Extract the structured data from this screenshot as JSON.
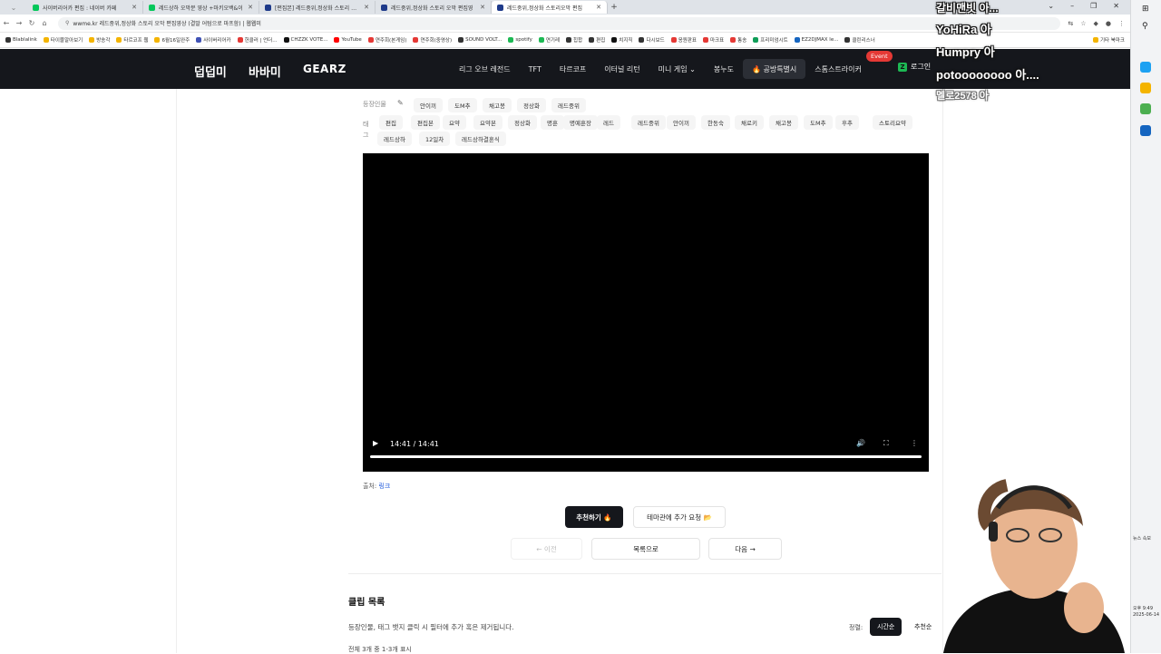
{
  "browser": {
    "tabs": [
      {
        "label": "사이버리어카 편집 : 네이버 카페",
        "color": "#03c75a"
      },
      {
        "label": "레드상하 오막분 영상 +마키오백&이",
        "color": "#03c75a"
      },
      {
        "label": "[편집본] 레드중위,정상화 스토리 오막",
        "color": "#1e3a8a"
      },
      {
        "label": "레드중위,정상화 스토리 오막 편집영",
        "color": "#1e3a8a"
      },
      {
        "label": "레드중위,정상화 스토리오막 편집",
        "color": "#1e3a8a"
      }
    ],
    "new_tab": "+",
    "url": "wwme.kr 레드중위,정상화 스토리 오막 편집영상 (결말 어텀으로 마프함) | 웹웹미",
    "bookmarks": [
      {
        "label": "Blablalink",
        "color": "#333"
      },
      {
        "label": "타이블알아보기",
        "color": "#f4b400"
      },
      {
        "label": "방송각",
        "color": "#f4b400"
      },
      {
        "label": "타르코프 웹",
        "color": "#f4b400"
      },
      {
        "label": "6월16일완주",
        "color": "#f4b400"
      },
      {
        "label": "사이버리어카",
        "color": "#3f51b5"
      },
      {
        "label": "헌클러 | 언더...",
        "color": "#e53935"
      },
      {
        "label": "CHZZK VOTE...",
        "color": "#111"
      },
      {
        "label": "YouTube",
        "color": "#ff0000"
      },
      {
        "label": "연주회(본게임)",
        "color": "#e53935"
      },
      {
        "label": "연주회(중영상)",
        "color": "#e53935"
      },
      {
        "label": "SOUND VOLT...",
        "color": "#333"
      },
      {
        "label": "spotify",
        "color": "#1db954"
      },
      {
        "label": "연기레",
        "color": "#1db954"
      },
      {
        "label": "힙합",
        "color": "#333"
      },
      {
        "label": "편집",
        "color": "#333"
      },
      {
        "label": "치지직",
        "color": "#111"
      },
      {
        "label": "다시보드",
        "color": "#333"
      },
      {
        "label": "응원판표",
        "color": "#e53935"
      },
      {
        "label": "마크표",
        "color": "#e53935"
      },
      {
        "label": "통송",
        "color": "#e53935"
      },
      {
        "label": "프리미엄시트",
        "color": "#0f9d58"
      },
      {
        "label": "EZ2DJMAX le...",
        "color": "#1565c0"
      },
      {
        "label": "클린리스너",
        "color": "#333"
      }
    ],
    "other_bookmarks": "기타 북마크"
  },
  "site": {
    "logos": [
      "덥덥미",
      "바바미",
      "GEARZ"
    ],
    "nav": [
      {
        "label": "리그 오브 레전드"
      },
      {
        "label": "TFT"
      },
      {
        "label": "타르코프"
      },
      {
        "label": "이터널 리턴"
      },
      {
        "label": "미니 게임 ⌄"
      },
      {
        "label": "봉누도"
      },
      {
        "label": "🔥 공방특별시"
      },
      {
        "label": "스톰스트라이커"
      }
    ],
    "event_badge": "Event",
    "login": "로그인"
  },
  "post": {
    "cast_label": "등장인물",
    "cast": [
      "안이끼",
      "도M추",
      "채고봉",
      "정상화",
      "레드중위"
    ],
    "tag_label": "태그",
    "tags_row1": [
      "편집",
      "편집본",
      "요약",
      "요약본",
      "정상화",
      "명훈",
      "명예훈장",
      "레드",
      "레드중위",
      "안이끼",
      "한동숙",
      "채로키",
      "채고봉",
      "도M추",
      "후추",
      "스토리요약"
    ],
    "tags_row2": [
      "레드상하",
      "12일차",
      "레드상하결혼식"
    ],
    "video": {
      "time": "14:41 / 14:41",
      "progress": 1.0
    },
    "source_label": "출처:",
    "source_link": "링크",
    "recommend_btn": "추천하기 🔥",
    "theme_request_btn": "테마관에 추가 요청 📂",
    "prev_btn": "← 이전",
    "list_btn": "목록으로",
    "next_btn": "다음 →"
  },
  "clips": {
    "title": "클립 목록",
    "hint": "등장인물, 태그 뱃지 클릭 시 필터에 추가 혹은 제거됩니다.",
    "total": "전체 3개 중 1-3개 표시",
    "sort_label": "정렬:",
    "sort_time": "시간순",
    "sort_reco": "추천순"
  },
  "overlay": {
    "line1": "갈비맨빗 아...",
    "line2": "YoHiRa 아",
    "line3": "Humpry 아",
    "line4": "potoooooooo 아....",
    "line5": "멜로2578 아"
  },
  "taskbar": {
    "time": "오후 9:49",
    "date": "2025-06-14",
    "news": "뉴스 속보"
  }
}
